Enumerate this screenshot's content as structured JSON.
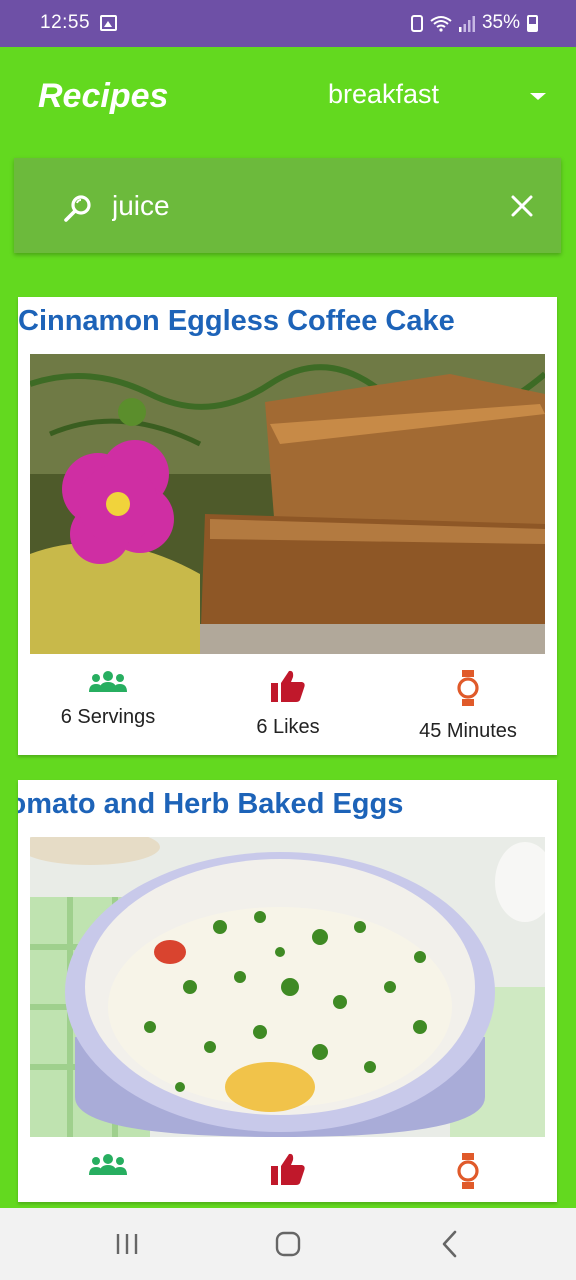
{
  "status_bar": {
    "time": "12:55",
    "battery": "35%"
  },
  "app_bar": {
    "title": "Recipes",
    "category": "breakfast"
  },
  "search": {
    "value": "juice"
  },
  "recipes": [
    {
      "title": "Cinnamon Eggless Coffee Cake",
      "servings": "6 Servings",
      "likes": "6 Likes",
      "time": "45 Minutes"
    },
    {
      "title": "Tomato and Herb Baked Eggs"
    }
  ],
  "colors": {
    "app_background": "#63d91f",
    "status_bar": "#6e50a6",
    "search_box": "#6cba3c",
    "title_blue": "#1d63b8",
    "servings_icon": "#27ae60",
    "likes_icon": "#c0182b",
    "time_icon": "#e05a2a"
  },
  "icons": {
    "servings": "group-icon",
    "likes": "thumb-up-icon",
    "time": "watch-icon",
    "search": "search-icon",
    "clear": "close-icon"
  }
}
